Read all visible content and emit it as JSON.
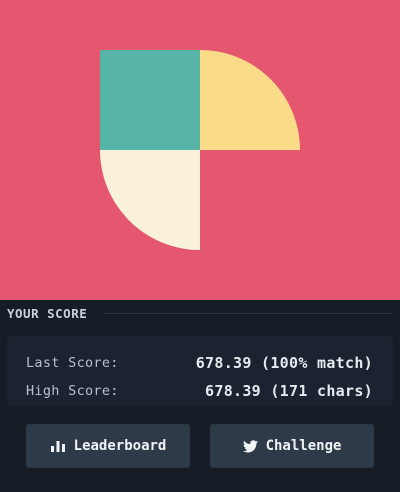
{
  "colors": {
    "canvas_bg": "#e5566f",
    "teal": "#56b5a6",
    "yellow": "#f9db88",
    "cream": "#f9f1d9",
    "panel_bg": "#161d27"
  },
  "score_panel": {
    "title": "YOUR SCORE",
    "last_label": "Last Score:",
    "last_value": "678.39 (100% match)",
    "high_label": "High Score:",
    "high_value": "678.39 (171 chars)"
  },
  "buttons": {
    "leaderboard_label": "Leaderboard",
    "leaderboard_icon": "bar-chart-icon",
    "challenge_label": "Challenge",
    "challenge_icon": "twitter-icon"
  }
}
